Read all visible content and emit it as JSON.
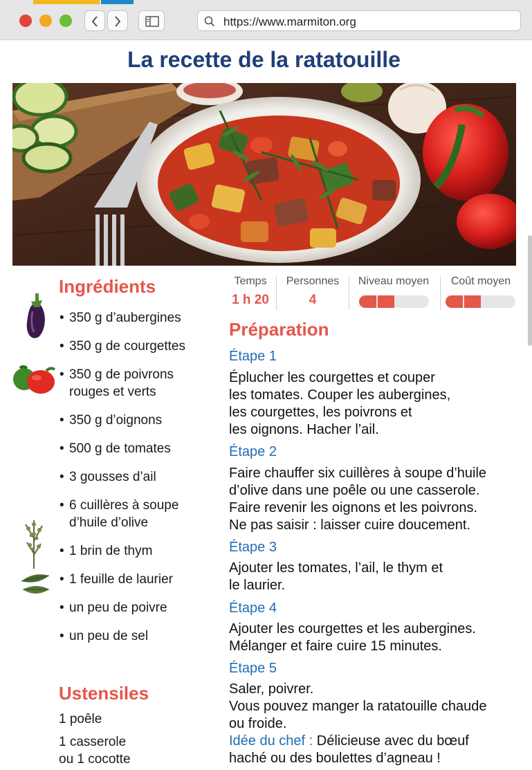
{
  "browser": {
    "url": "https://www.marmiton.org"
  },
  "page": {
    "title": "La recette de la ratatouille",
    "hero_image": "ratatouille-dish-photo"
  },
  "ingredients": {
    "title": "Ingrédients",
    "items": [
      {
        "lines": [
          "350 g d’aubergines"
        ]
      },
      {
        "lines": [
          "350 g de courgettes"
        ]
      },
      {
        "lines": [
          "350 g de poivrons",
          "rouges et verts"
        ]
      },
      {
        "lines": [
          "350 g d’oignons"
        ]
      },
      {
        "lines": [
          "500 g de tomates"
        ]
      },
      {
        "lines": [
          "3 gousses d’ail"
        ]
      },
      {
        "lines": [
          "6 cuillères à soupe",
          "d’huile d’olive"
        ]
      },
      {
        "lines": [
          "1 brin de thym"
        ]
      },
      {
        "lines": [
          "1 feuille de laurier"
        ]
      },
      {
        "lines": [
          "un peu de poivre"
        ]
      },
      {
        "lines": [
          "un peu de sel"
        ]
      }
    ],
    "icons": [
      "eggplant-icon",
      "peppers-icon",
      "thyme-icon",
      "bay-leaf-icon"
    ]
  },
  "utensils": {
    "title": "Ustensiles",
    "items": [
      "1 poêle",
      "1 casserole",
      "ou 1 cocotte"
    ]
  },
  "info": {
    "temps": {
      "label": "Temps",
      "value": "1 h 20"
    },
    "personnes": {
      "label": "Personnes",
      "value": "4"
    },
    "niveau": {
      "label": "Niveau moyen",
      "level": 2,
      "max": 4
    },
    "cout": {
      "label": "Coût moyen",
      "level": 2,
      "max": 4
    }
  },
  "preparation": {
    "title": "Préparation",
    "steps": [
      {
        "label": "Étape 1",
        "lines": [
          "Éplucher les courgettes et couper",
          "les tomates. Couper les aubergines,",
          "les courgettes, les poivrons et",
          "les oignons. Hacher l’ail."
        ]
      },
      {
        "label": "Étape 2",
        "lines": [
          "Faire chauffer six cuillères à soupe d’huile",
          "d’olive dans une poêle ou une casserole.",
          "Faire revenir les oignons et les poivrons.",
          "Ne pas saisir : laisser cuire doucement."
        ]
      },
      {
        "label": "Étape 3",
        "lines": [
          "Ajouter les tomates, l’ail, le thym et",
          "le laurier."
        ]
      },
      {
        "label": "Étape 4",
        "lines": [
          "Ajouter les courgettes et les aubergines.",
          "Mélanger et faire cuire 15 minutes."
        ]
      },
      {
        "label": "Étape 5",
        "lines": [
          "Saler, poivrer.",
          "Vous pouvez manger la ratatouille chaude",
          "ou froide."
        ]
      }
    ],
    "chef_tip": {
      "label": "Idée du chef :",
      "lines": [
        " Délicieuse avec du bœuf",
        "haché ou des boulettes d’agneau !"
      ]
    }
  },
  "colors": {
    "title_blue": "#1f3f78",
    "accent_red": "#e4574b",
    "step_blue": "#1f6db5"
  }
}
